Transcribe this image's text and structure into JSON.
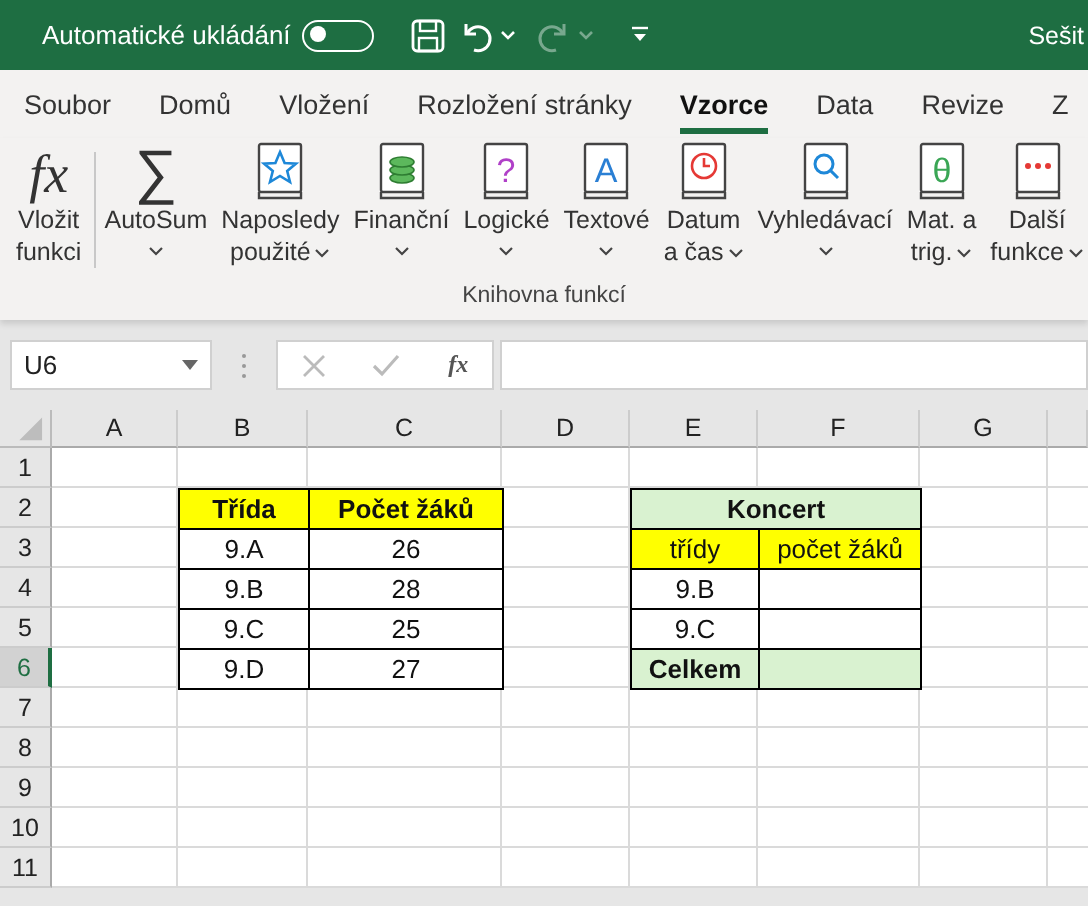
{
  "title_bar": {
    "autosave_label": "Automatické ukládání",
    "autosave_on": false,
    "redo_disabled": true,
    "document_title": "Sešit"
  },
  "tabs": [
    {
      "label": "Soubor",
      "selected": false
    },
    {
      "label": "Domů",
      "selected": false
    },
    {
      "label": "Vložení",
      "selected": false
    },
    {
      "label": "Rozložení stránky",
      "selected": false
    },
    {
      "label": "Vzorce",
      "selected": true
    },
    {
      "label": "Data",
      "selected": false
    },
    {
      "label": "Revize",
      "selected": false
    },
    {
      "label": "Z",
      "selected": false
    }
  ],
  "ribbon": {
    "group_label": "Knihovna funkcí",
    "buttons": [
      {
        "kind": "fx",
        "glyph": "fx",
        "lines": [
          "Vložit",
          "funkci"
        ]
      },
      {
        "kind": "sum",
        "glyph": "∑",
        "lines": [
          "AutoSum"
        ],
        "dropdown": true
      },
      {
        "kind": "star-book",
        "lines": [
          "Naposledy",
          "použité"
        ],
        "dropdown": true
      },
      {
        "kind": "coins-book",
        "lines": [
          "Finanční"
        ],
        "dropdown": true
      },
      {
        "kind": "glyph-book",
        "glyph": "?",
        "color": "#b040c8",
        "lines": [
          "Logické"
        ],
        "dropdown": true
      },
      {
        "kind": "glyph-book",
        "glyph": "A",
        "color": "#2a7fd4",
        "lines": [
          "Textové"
        ],
        "dropdown": true
      },
      {
        "kind": "clock-book",
        "lines": [
          "Datum",
          "a čas"
        ],
        "dropdown": true
      },
      {
        "kind": "search-book",
        "lines": [
          "Vyhledávací"
        ],
        "dropdown": true
      },
      {
        "kind": "glyph-book",
        "glyph": "θ",
        "color": "#3aa655",
        "lines": [
          "Mat. a",
          "trig."
        ],
        "dropdown": true
      },
      {
        "kind": "dots-book",
        "lines": [
          "Další",
          "funkce"
        ],
        "dropdown": true
      }
    ]
  },
  "formula_bar": {
    "name_box": "U6",
    "fx": "fx"
  },
  "sheet": {
    "columns": [
      "A",
      "B",
      "C",
      "D",
      "E",
      "F",
      "G"
    ],
    "rows": [
      {
        "number": "1",
        "selected": false
      },
      {
        "number": "2",
        "selected": false,
        "cells": [
          {},
          {
            "text": "Třída",
            "kind": "header"
          },
          {
            "text": "Počet žáků",
            "kind": "header"
          },
          {},
          {
            "text": "Koncert",
            "kind": "title",
            "merged": true
          },
          {}
        ]
      },
      {
        "number": "3",
        "selected": false,
        "cells": [
          {},
          {
            "text": "9.A",
            "kind": "data"
          },
          {
            "text": "26",
            "kind": "data"
          },
          {},
          {
            "text": "třídy",
            "kind": "subheader"
          },
          {
            "text": "počet žáků",
            "kind": "subheader"
          },
          {}
        ]
      },
      {
        "number": "4",
        "selected": false,
        "cells": [
          {},
          {
            "text": "9.B",
            "kind": "data"
          },
          {
            "text": "28",
            "kind": "data"
          },
          {},
          {
            "text": "9.B",
            "kind": "data"
          },
          {
            "kind": "data"
          },
          {}
        ]
      },
      {
        "number": "5",
        "selected": false,
        "cells": [
          {},
          {
            "text": "9.C",
            "kind": "data"
          },
          {
            "text": "25",
            "kind": "data"
          },
          {},
          {
            "text": "9.C",
            "kind": "data"
          },
          {
            "kind": "data"
          },
          {}
        ]
      },
      {
        "number": "6",
        "selected": true,
        "cells": [
          {},
          {
            "text": "9.D",
            "kind": "data"
          },
          {
            "text": "27",
            "kind": "data"
          },
          {},
          {
            "text": "Celkem",
            "kind": "total"
          },
          {
            "kind": "total"
          },
          {}
        ]
      },
      {
        "number": "7",
        "selected": false
      },
      {
        "number": "8",
        "selected": false
      },
      {
        "number": "9",
        "selected": false
      },
      {
        "number": "10",
        "selected": false
      },
      {
        "number": "11",
        "selected": false
      }
    ]
  }
}
